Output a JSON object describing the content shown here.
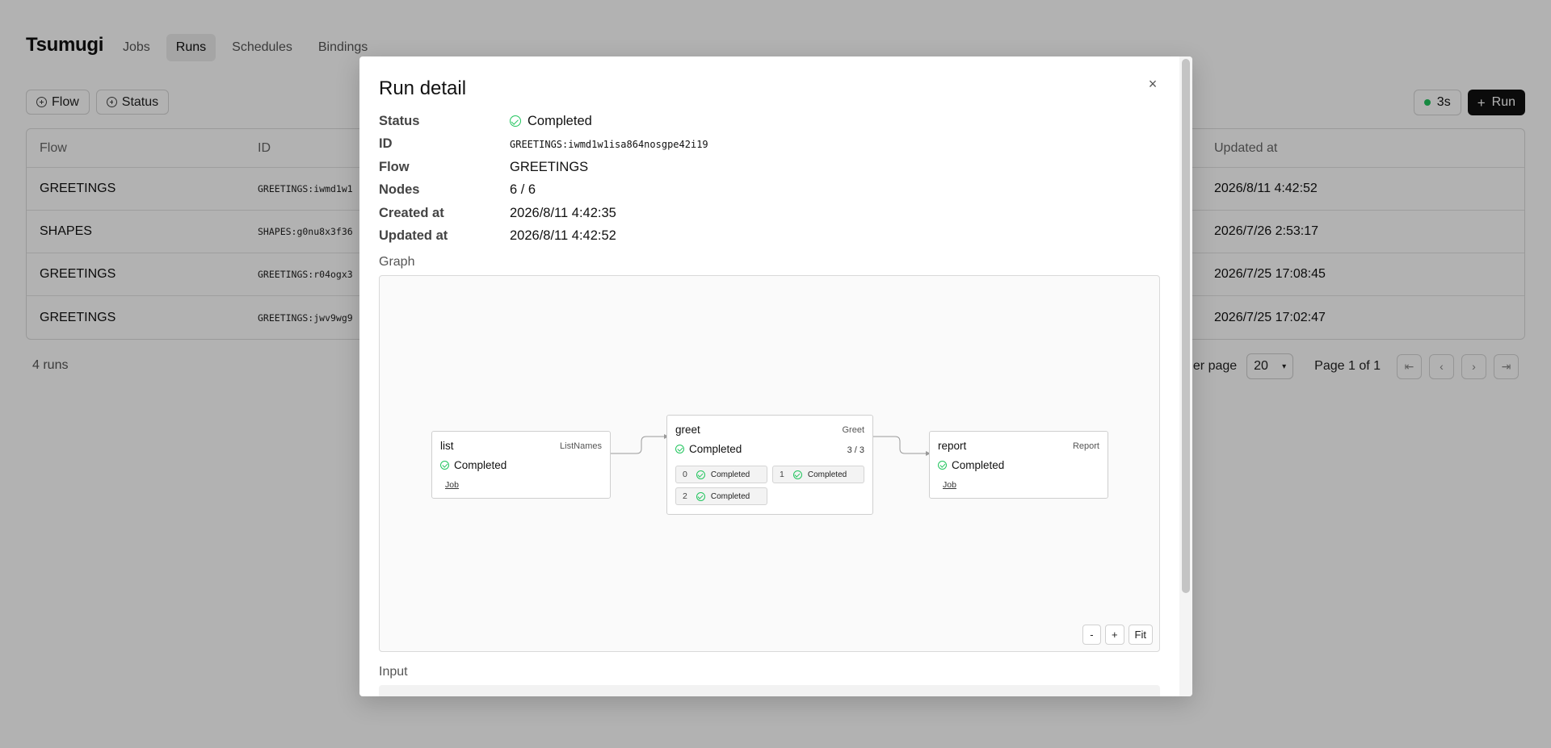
{
  "app": {
    "title": "Tsumugi"
  },
  "nav": {
    "items": [
      {
        "label": "Jobs"
      },
      {
        "label": "Runs"
      },
      {
        "label": "Schedules"
      },
      {
        "label": "Bindings"
      }
    ]
  },
  "filters": {
    "flow_label": "Flow",
    "status_label": "Status"
  },
  "toolbar": {
    "refresh_label": "3s",
    "run_label": "Run"
  },
  "table": {
    "headers": {
      "flow": "Flow",
      "id": "ID",
      "updated_at": "Updated at"
    },
    "rows": [
      {
        "flow": "GREETINGS",
        "id": "GREETINGS:iwmd1w1",
        "updated_at": "2026/8/11 4:42:52"
      },
      {
        "flow": "SHAPES",
        "id": "SHAPES:g0nu8x3f36",
        "updated_at": "2026/7/26 2:53:17"
      },
      {
        "flow": "GREETINGS",
        "id": "GREETINGS:r04ogx3",
        "updated_at": "2026/7/25 17:08:45"
      },
      {
        "flow": "GREETINGS",
        "id": "GREETINGS:jwv9wg9",
        "updated_at": "2026/7/25 17:02:47"
      }
    ]
  },
  "footer": {
    "run_count": "4 runs",
    "per_page_label": "er page",
    "per_page_value": "20",
    "page_info": "Page 1 of 1"
  },
  "modal": {
    "title": "Run detail",
    "close_label": "×",
    "details": {
      "status_label": "Status",
      "status_value": "Completed",
      "id_label": "ID",
      "id_value": "GREETINGS:iwmd1w1isa864nosgpe42i19",
      "flow_label": "Flow",
      "flow_value": "GREETINGS",
      "nodes_label": "Nodes",
      "nodes_value": "6 / 6",
      "created_label": "Created at",
      "created_value": "2026/8/11 4:42:35",
      "updated_label": "Updated at",
      "updated_value": "2026/8/11 4:42:52"
    },
    "graph_label": "Graph",
    "input_label": "Input",
    "graph": {
      "list": {
        "name": "list",
        "type": "ListNames",
        "status": "Completed",
        "link": "Job"
      },
      "greet": {
        "name": "greet",
        "type": "Greet",
        "status": "Completed",
        "progress": "3 / 3",
        "chips": [
          {
            "index": "0",
            "status": "Completed"
          },
          {
            "index": "1",
            "status": "Completed"
          },
          {
            "index": "2",
            "status": "Completed"
          }
        ]
      },
      "report": {
        "name": "report",
        "type": "Report",
        "status": "Completed",
        "link": "Job"
      }
    },
    "zoom": {
      "minus": "-",
      "plus": "+",
      "fit": "Fit"
    }
  },
  "colors": {
    "success": "#22c55e",
    "primary_button": "#111111"
  }
}
